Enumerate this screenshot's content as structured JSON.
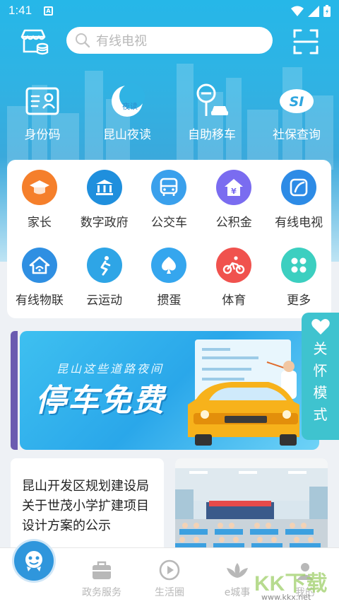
{
  "status": {
    "time": "1:41",
    "notice_badge": "A"
  },
  "search": {
    "placeholder": "有线电视"
  },
  "quick_items": [
    {
      "label": "身份码",
      "icon": "id-card-icon"
    },
    {
      "label": "昆山夜读",
      "icon": "moon-read-icon",
      "badge": "夜读"
    },
    {
      "label": "自助移车",
      "icon": "move-car-icon"
    },
    {
      "label": "社保查询",
      "icon": "social-security-icon",
      "badge": "SI"
    }
  ],
  "services": [
    {
      "label": "家长",
      "icon": "graduation-cap-icon",
      "color": "#f57f2b"
    },
    {
      "label": "数字政府",
      "icon": "government-icon",
      "color": "#1f8fdd"
    },
    {
      "label": "公交车",
      "icon": "bus-icon",
      "color": "#3aa0ec"
    },
    {
      "label": "公积金",
      "icon": "housing-fund-icon",
      "color": "#7a6cf0"
    },
    {
      "label": "有线电视",
      "icon": "tv-icon",
      "color": "#2d8be6"
    },
    {
      "label": "有线物联",
      "icon": "smart-home-icon",
      "color": "#2f8fe2"
    },
    {
      "label": "云运动",
      "icon": "sport-icon",
      "color": "#2ea5e6"
    },
    {
      "label": "掼蛋",
      "icon": "spade-icon",
      "color": "#35a6ee"
    },
    {
      "label": "体育",
      "icon": "cycling-icon",
      "color": "#f0524e"
    },
    {
      "label": "更多",
      "icon": "more-icon",
      "color": "#3ccfc0"
    }
  ],
  "care_mode": {
    "label_chars": [
      "关",
      "怀",
      "模",
      "式"
    ]
  },
  "banner": {
    "subtitle": "昆山这些道路夜间",
    "title": "停车免费"
  },
  "news": {
    "title": "昆山开发区规划建设局关于世茂小学扩建项目设计方案的公示"
  },
  "bottom_nav": [
    {
      "label": "",
      "icon": "home-mascot-icon"
    },
    {
      "label": "政务服务",
      "icon": "briefcase-icon"
    },
    {
      "label": "生活圈",
      "icon": "play-circle-icon"
    },
    {
      "label": "e城事",
      "icon": "lotus-icon"
    },
    {
      "label": "我的",
      "icon": "user-icon"
    }
  ],
  "watermark": {
    "logo": "KK下载",
    "url": "www.kkx.net"
  }
}
